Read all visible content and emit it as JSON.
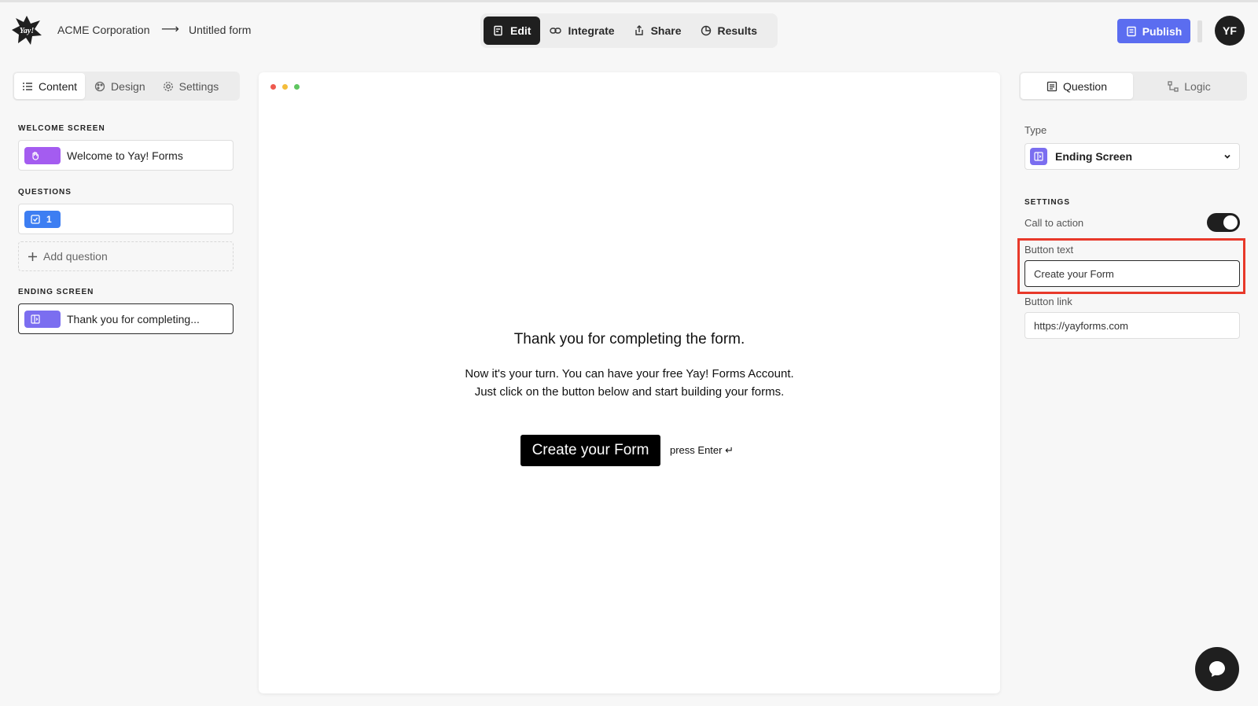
{
  "header": {
    "org_name": "ACME Corporation",
    "breadcrumb_arrow": "⟶",
    "form_name": "Untitled form",
    "nav": [
      {
        "label": "Edit",
        "icon": "edit-icon",
        "active": true
      },
      {
        "label": "Integrate",
        "icon": "link-icon",
        "active": false
      },
      {
        "label": "Share",
        "icon": "share-icon",
        "active": false
      },
      {
        "label": "Results",
        "icon": "chart-icon",
        "active": false
      }
    ],
    "publish_label": "Publish",
    "avatar_initials": "YF"
  },
  "left_panel": {
    "tabs": [
      {
        "label": "Content",
        "icon": "list-icon",
        "active": true
      },
      {
        "label": "Design",
        "icon": "palette-icon",
        "active": false
      },
      {
        "label": "Settings",
        "icon": "gear-icon",
        "active": false
      }
    ],
    "welcome_label": "WELCOME SCREEN",
    "welcome_item": "Welcome to Yay! Forms",
    "questions_label": "QUESTIONS",
    "question_number": "1",
    "add_question": "Add question",
    "ending_label": "ENDING SCREEN",
    "ending_item": "Thank you for completing..."
  },
  "preview": {
    "title": "Thank you for completing the form.",
    "body_line1": "Now it's your turn. You can have your free Yay! Forms Account.",
    "body_line2": "Just click on the button below and start building your forms.",
    "button_label": "Create your Form",
    "hint": "press Enter ↵"
  },
  "right_panel": {
    "tabs": [
      {
        "label": "Question",
        "icon": "question-icon",
        "active": true
      },
      {
        "label": "Logic",
        "icon": "logic-icon",
        "active": false
      }
    ],
    "type_label": "Type",
    "type_value": "Ending Screen",
    "settings_label": "SETTINGS",
    "cta_label": "Call to action",
    "cta_enabled": true,
    "button_text_label": "Button text",
    "button_text_value": "Create your Form",
    "button_link_label": "Button link",
    "button_link_value": "https://yayforms.com"
  },
  "colors": {
    "accent": "#5b6df0",
    "welcome_chip": "#a45cf0",
    "question_chip": "#3d7ef2",
    "ending_chip": "#7b6ef0",
    "highlight": "#e8392a",
    "dark": "#1f1f1f"
  }
}
